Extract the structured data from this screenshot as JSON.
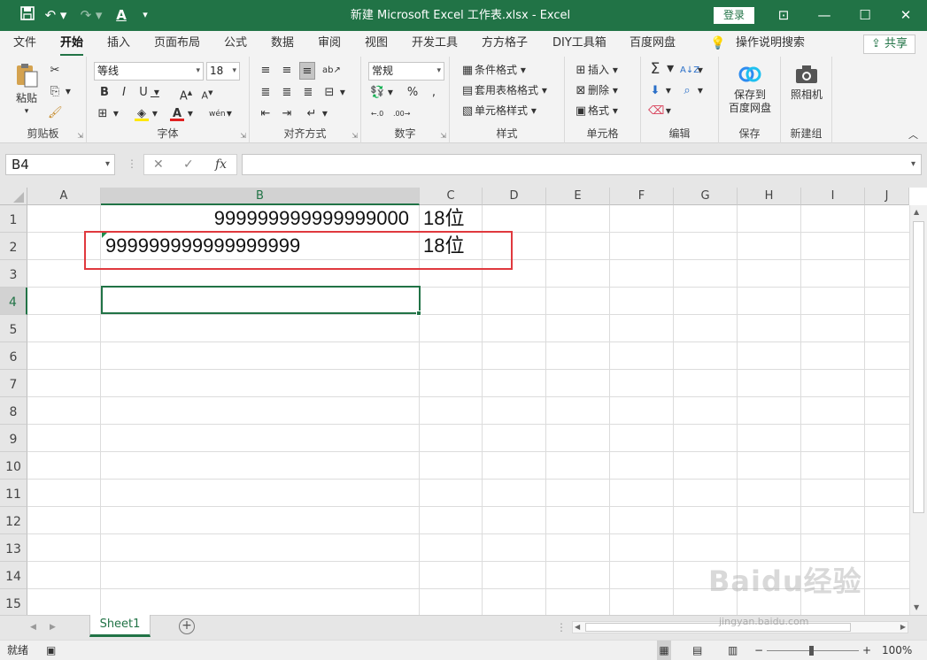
{
  "titlebar": {
    "title": "新建 Microsoft Excel 工作表.xlsx  -  Excel",
    "login": "登录",
    "save_icon": "save-icon",
    "undo_icon": "undo-icon",
    "redo_icon": "redo-icon",
    "font_color_icon": "font-color-icon",
    "customize_icon": "chevron-down-icon",
    "ribbon_display": "⊡",
    "minimize": "—",
    "maximize": "☐",
    "close": "✕"
  },
  "tabs": [
    "文件",
    "开始",
    "插入",
    "页面布局",
    "公式",
    "数据",
    "审阅",
    "视图",
    "开发工具",
    "方方格子",
    "DIY工具箱",
    "百度网盘"
  ],
  "active_tab": "开始",
  "tell_me": "操作说明搜索",
  "share": "共享",
  "ribbon": {
    "clipboard": {
      "label": "剪贴板",
      "paste": "粘贴"
    },
    "font": {
      "label": "字体",
      "font_name": "等线",
      "font_size": "18"
    },
    "alignment": {
      "label": "对齐方式"
    },
    "number": {
      "label": "数字",
      "format": "常规"
    },
    "styles": {
      "label": "样式",
      "conditional": "条件格式",
      "table": "套用表格格式",
      "cell_styles": "单元格样式"
    },
    "cells": {
      "label": "单元格",
      "insert": "插入",
      "delete": "删除",
      "format": "格式"
    },
    "editing": {
      "label": "编辑"
    },
    "save": {
      "label": "保存",
      "line1": "保存到",
      "line2": "百度网盘"
    },
    "newgroup": {
      "label": "新建组",
      "camera": "照相机"
    }
  },
  "formula_bar": {
    "name_box": "B4",
    "fx": "fx",
    "content": ""
  },
  "columns": [
    "A",
    "B",
    "C",
    "D",
    "E",
    "F",
    "G",
    "H",
    "I",
    "J"
  ],
  "rows": [
    "1",
    "2",
    "3",
    "4",
    "5",
    "6",
    "7",
    "8",
    "9",
    "10",
    "11",
    "12",
    "13",
    "14",
    "15"
  ],
  "cells": {
    "B1": "999999999999999000",
    "C1": "18位",
    "B2": "999999999999999999",
    "C2": "18位"
  },
  "selected_cell": "B4",
  "highlight_color": "#e0393e",
  "accent_color": "#217346",
  "sheet_tab": "Sheet1",
  "status": {
    "ready": "就绪",
    "zoom": "100%"
  },
  "watermark": {
    "brand": "Baidu经验",
    "url": "jingyan.baidu.com"
  }
}
